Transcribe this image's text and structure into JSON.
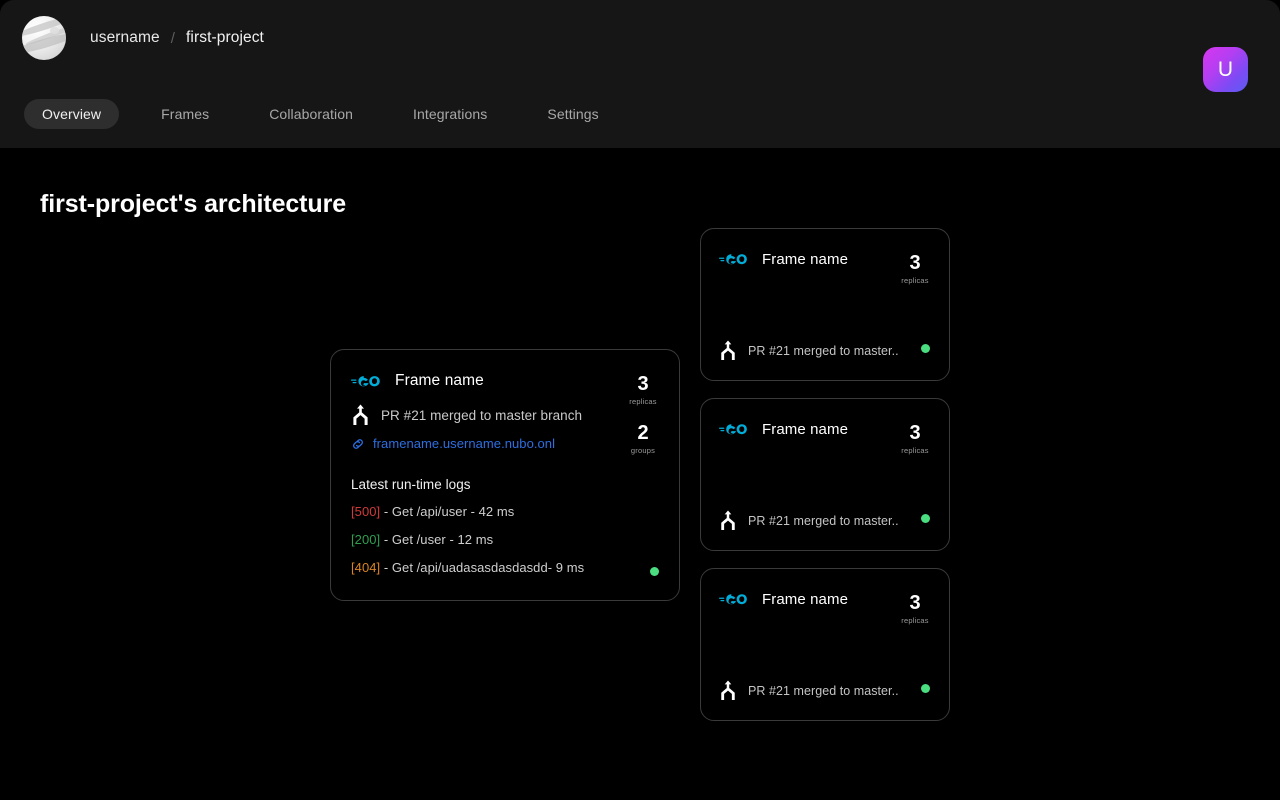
{
  "header": {
    "logo_icon": "planet-orb-logo",
    "breadcrumb": {
      "user": "username",
      "separator": "/",
      "project": "first-project"
    },
    "avatar": {
      "initial": "U",
      "gradient_from": "#d736ef",
      "gradient_to": "#5a5cf5"
    },
    "tabs": [
      {
        "label": "Overview",
        "active": true
      },
      {
        "label": "Frames",
        "active": false
      },
      {
        "label": "Collaboration",
        "active": false
      },
      {
        "label": "Integrations",
        "active": false
      },
      {
        "label": "Settings",
        "active": false
      }
    ]
  },
  "main": {
    "page_title": "first-project's architecture",
    "main_card": {
      "runtime_icon": "go-logo-icon",
      "frame_name": "Frame name",
      "replicas": {
        "value": "3",
        "label": "replicas"
      },
      "groups": {
        "value": "2",
        "label": "groups"
      },
      "merge_icon": "git-merge-icon",
      "merge_text": "PR #21 merged to master branch",
      "link_icon": "chain-link-icon",
      "link_text": "framename.username.nubo.onl",
      "logs_title": "Latest run-time logs",
      "logs": [
        {
          "code": "[500]",
          "color": "#cf3a3a",
          "text": " - Get /api/user - 42 ms"
        },
        {
          "code": "[200]",
          "color": "#2f9e4f",
          "text": " - Get /user - 12 ms"
        },
        {
          "code": "[404]",
          "color": "#d98324",
          "text": " - Get /api/uadasasdasdasdd- 9 ms"
        }
      ],
      "status": {
        "icon": "status-dot",
        "color": "#4ade80"
      }
    },
    "side_cards": [
      {
        "runtime_icon": "go-logo-icon",
        "frame_name": "Frame name",
        "replicas": {
          "value": "3",
          "label": "replicas"
        },
        "merge_icon": "git-merge-icon",
        "merge_text": "PR #21 merged to master..",
        "status": {
          "icon": "status-dot",
          "color": "#4ade80"
        }
      },
      {
        "runtime_icon": "go-logo-icon",
        "frame_name": "Frame name",
        "replicas": {
          "value": "3",
          "label": "replicas"
        },
        "merge_icon": "git-merge-icon",
        "merge_text": "PR #21 merged to master..",
        "status": {
          "icon": "status-dot",
          "color": "#4ade80"
        }
      },
      {
        "runtime_icon": "go-logo-icon",
        "frame_name": "Frame name",
        "replicas": {
          "value": "3",
          "label": "replicas"
        },
        "merge_icon": "git-merge-icon",
        "merge_text": "PR #21 merged to master..",
        "status": {
          "icon": "status-dot",
          "color": "#4ade80"
        }
      }
    ]
  }
}
